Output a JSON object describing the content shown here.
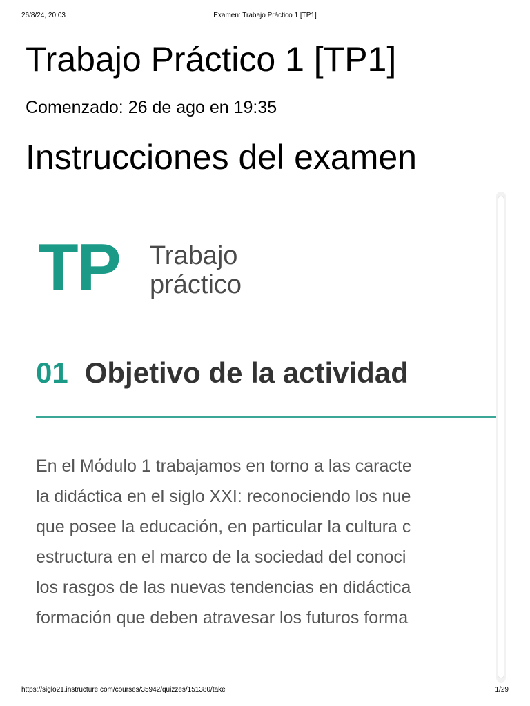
{
  "print_header": {
    "date": "26/8/24, 20:03",
    "title": "Examen: Trabajo Práctico 1 [TP1]"
  },
  "page": {
    "title": "Trabajo Práctico 1 [TP1]",
    "started": "Comenzado: 26 de ago en 19:35",
    "instructions_heading": "Instrucciones del examen"
  },
  "content": {
    "logo": {
      "letters": "TP",
      "text_line1": "Trabajo",
      "text_line2": "práctico",
      "color": "#1a9a87"
    },
    "section": {
      "number": "01",
      "title": "Objetivo de la actividad"
    },
    "paragraph_lines": [
      "En el Módulo 1 trabajamos en torno a las caracte",
      "la didáctica en el siglo XXI: reconociendo los nue",
      "que posee la educación, en particular la cultura c",
      "estructura en el marco de la sociedad del conoci",
      "los rasgos de las nuevas tendencias en didáctica",
      "formación que deben atravesar los futuros forma"
    ]
  },
  "print_footer": {
    "url": "https://siglo21.instructure.com/courses/35942/quizzes/151380/take",
    "page": "1/29"
  }
}
